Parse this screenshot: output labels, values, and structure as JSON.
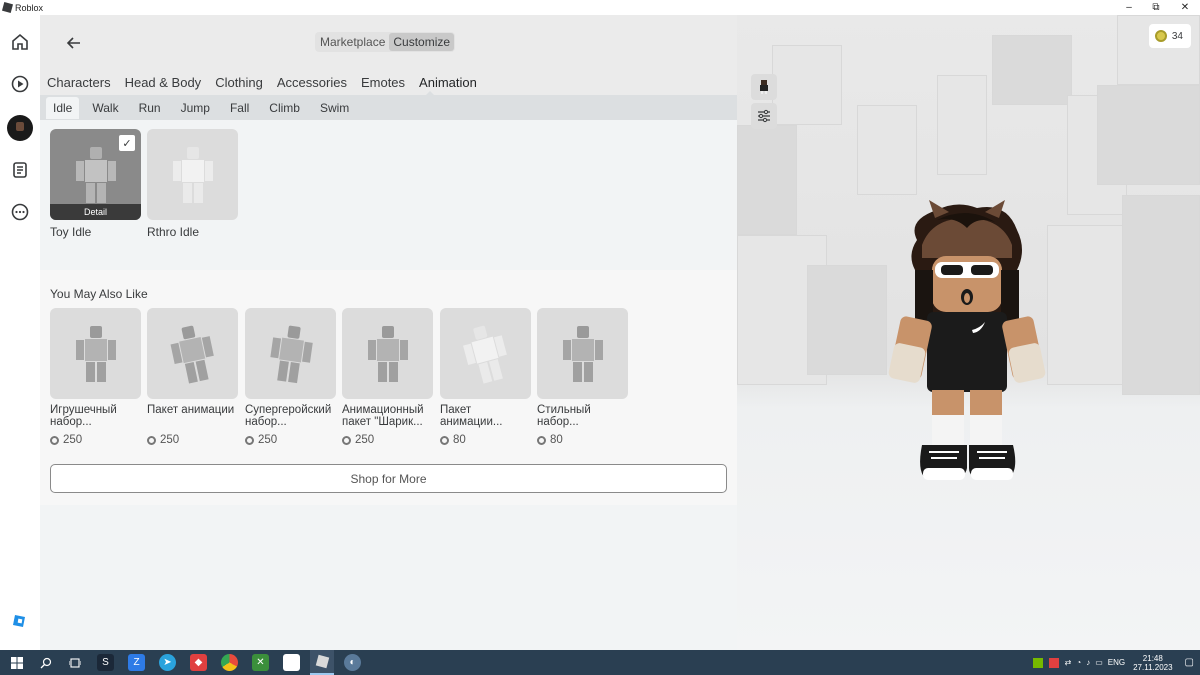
{
  "window": {
    "title": "Roblox",
    "controls": {
      "minimize": "–",
      "restore": "⧉",
      "close": "✕"
    }
  },
  "header": {
    "back_icon": "arrow-left-icon",
    "segments": [
      {
        "label": "Marketplace",
        "active": false
      },
      {
        "label": "Customize",
        "active": true
      }
    ]
  },
  "category_tabs": [
    {
      "label": "Characters",
      "active": false
    },
    {
      "label": "Head & Body",
      "active": false
    },
    {
      "label": "Clothing",
      "active": false
    },
    {
      "label": "Accessories",
      "active": false
    },
    {
      "label": "Emotes",
      "active": false
    },
    {
      "label": "Animation",
      "active": true
    }
  ],
  "sub_tabs": [
    {
      "label": "Idle",
      "active": true
    },
    {
      "label": "Walk",
      "active": false
    },
    {
      "label": "Run",
      "active": false
    },
    {
      "label": "Jump",
      "active": false
    },
    {
      "label": "Fall",
      "active": false
    },
    {
      "label": "Climb",
      "active": false
    },
    {
      "label": "Swim",
      "active": false
    }
  ],
  "owned_items": [
    {
      "name": "Toy Idle",
      "selected": true,
      "detail_label": "Detail"
    },
    {
      "name": "Rthro Idle",
      "selected": false
    }
  ],
  "recommendations": {
    "title": "You May Also Like",
    "items": [
      {
        "name": "Игрушечный набор...",
        "price": "250"
      },
      {
        "name": "Пакет анимации",
        "price": "250"
      },
      {
        "name": "Супергеройский набор...",
        "price": "250"
      },
      {
        "name": "Анимационный пакет \"Шарик...",
        "price": "250"
      },
      {
        "name": "Пакет анимации...",
        "price": "80"
      },
      {
        "name": "Стильный набор...",
        "price": "80"
      }
    ],
    "shop_button": "Shop for More"
  },
  "preview": {
    "robux_balance": "34"
  },
  "taskbar": {
    "language": "ENG",
    "time": "21:48",
    "date": "27.11.2023"
  },
  "colors": {
    "accent_text": "#393b3d",
    "panel_bg": "#f2f4f5",
    "taskbar_bg": "#2a3f52"
  }
}
